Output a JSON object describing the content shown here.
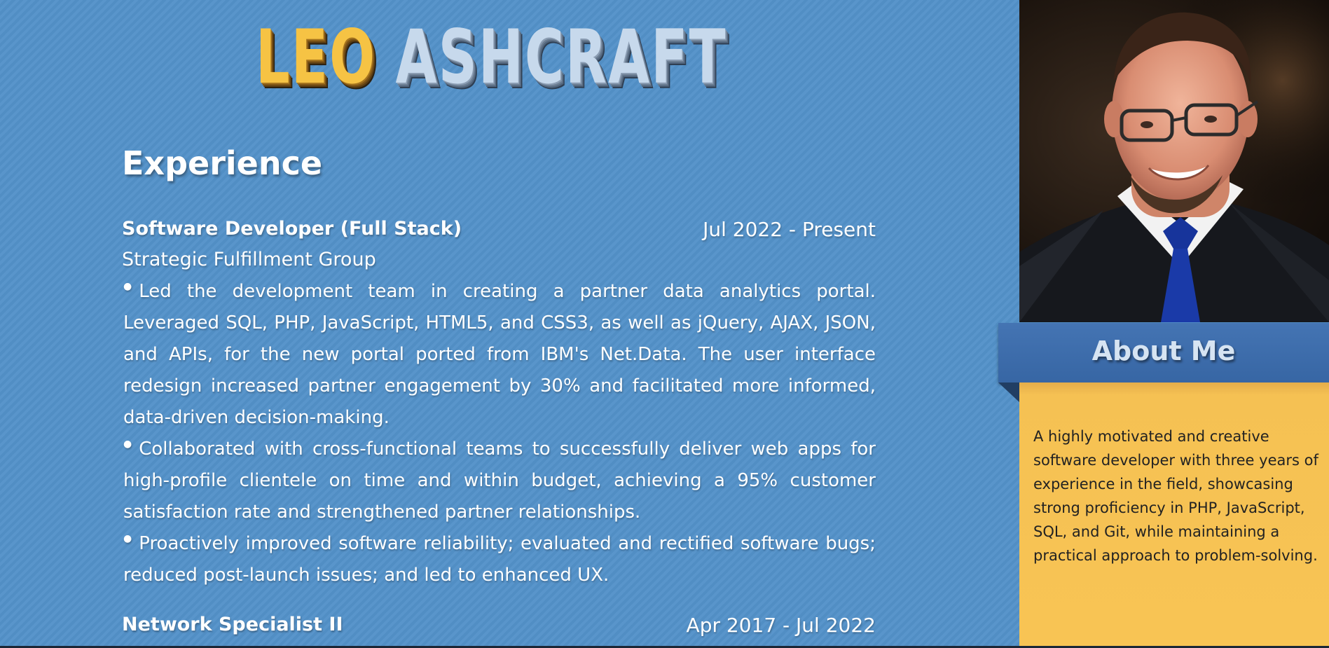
{
  "header": {
    "first_name": "LEO",
    "last_name": "ASHCRAFT"
  },
  "experience": {
    "title": "Experience",
    "jobs": [
      {
        "title": "Software Developer (Full Stack)",
        "dates": "Jul 2022 - Present",
        "company": "Strategic Fulfillment Group",
        "bullets": [
          "Led the development team in creating a partner data analytics portal. Leveraged SQL, PHP, JavaScript, HTML5, and CSS3, as well as jQuery, AJAX, JSON, and APIs, for the new portal ported from IBM's Net.Data. The user interface redesign increased partner engagement by 30% and facilitated more informed, data-driven decision-making.",
          "Collaborated with cross-functional teams to successfully deliver web apps for high-profile clientele on time and within budget, achieving a 95% customer satisfaction rate and strengthened partner relationships.",
          "Proactively improved software reliability; evaluated and rectified software bugs; reduced post-launch issues; and led to enhanced UX."
        ]
      },
      {
        "title": "Network Specialist II",
        "dates": "Apr 2017 - Jul 2022"
      }
    ]
  },
  "about": {
    "title": "About Me",
    "text": "A highly motivated and creative software developer with three years of experience in the field, showcasing strong proficiency in PHP, JavaScript, SQL, and Git, while maintaining a practical approach to problem-solving."
  },
  "icons": {
    "bullet": "bullet-dot-icon"
  },
  "colors": {
    "background_blue": "#5391c9",
    "accent_gold": "#f6c344",
    "about_header_blue": "#3d6eae",
    "about_box_gold": "#f8c454"
  }
}
